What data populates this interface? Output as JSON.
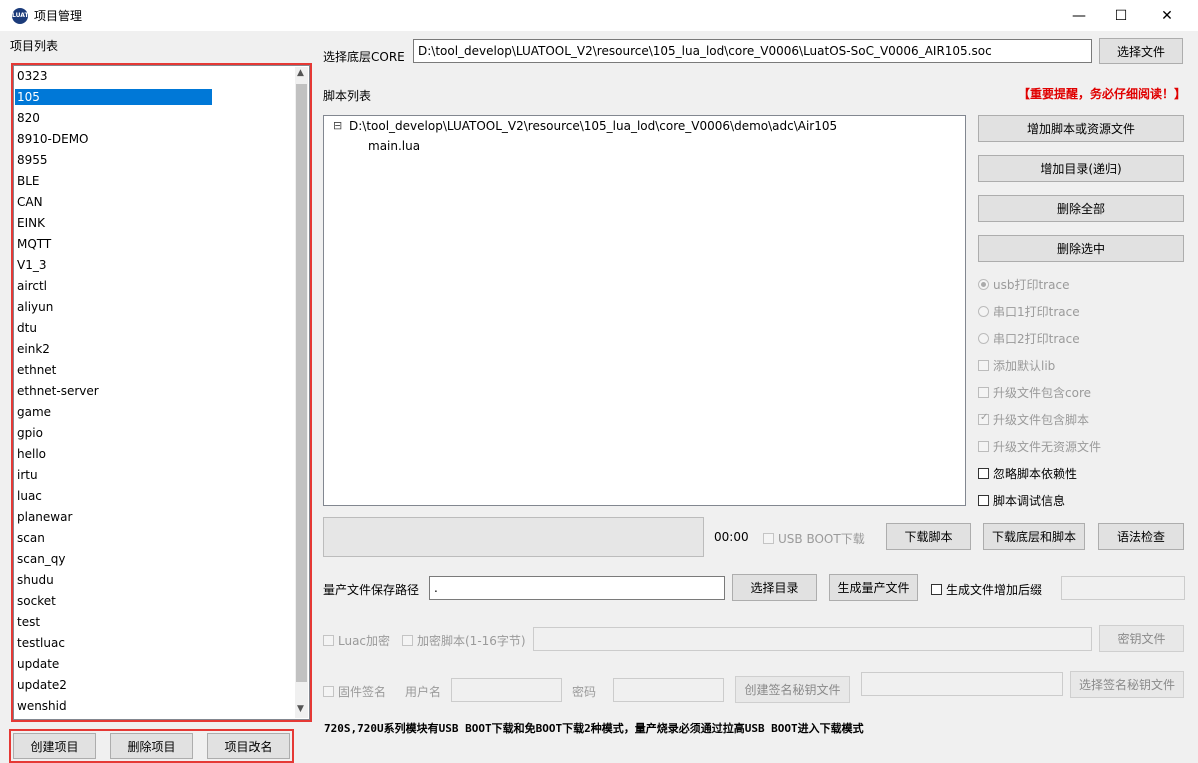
{
  "window": {
    "title": "项目管理",
    "minimize": "—",
    "maximize": "☐",
    "close": "✕"
  },
  "project_list": {
    "label": "项目列表",
    "selected": "105",
    "items": [
      "0323",
      "105",
      "820",
      "8910-DEMO",
      "8955",
      "BLE",
      "CAN",
      "EINK",
      "MQTT",
      "V1_3",
      "airctl",
      "aliyun",
      "dtu",
      "eink2",
      "ethnet",
      "ethnet-server",
      "game",
      "gpio",
      "hello",
      "irtu",
      "luac",
      "planewar",
      "scan",
      "scan_qy",
      "shudu",
      "socket",
      "test",
      "testluac",
      "update",
      "update2",
      "wenshid"
    ],
    "create_button": "创建项目",
    "delete_button": "删除项目",
    "rename_button": "项目改名"
  },
  "core": {
    "label": "选择底层CORE",
    "path": "D:\\tool_develop\\LUATOOL_V2\\resource\\105_lua_lod\\core_V0006\\LuatOS-SoC_V0006_AIR105.soc",
    "select_button": "选择文件"
  },
  "scripts": {
    "label": "脚本列表",
    "warning": "【重要提醒，务必仔细阅读！】",
    "tree_toggle": "⊟",
    "folder": "D:\\tool_develop\\LUATOOL_V2\\resource\\105_lua_lod\\core_V0006\\demo\\adc\\Air105",
    "files": [
      "main.lua"
    ]
  },
  "side_buttons": {
    "add_script": "增加脚本或资源文件",
    "add_dir": "增加目录(递归)",
    "delete_all": "删除全部",
    "delete_selected": "删除选中"
  },
  "options": [
    {
      "label": "usb打印trace",
      "kind": "radio",
      "enabled": false,
      "checked": true
    },
    {
      "label": "串口1打印trace",
      "kind": "radio",
      "enabled": false,
      "checked": false
    },
    {
      "label": "串口2打印trace",
      "kind": "radio",
      "enabled": false,
      "checked": false
    },
    {
      "label": "添加默认lib",
      "kind": "check",
      "enabled": false,
      "checked": false
    },
    {
      "label": "升级文件包含core",
      "kind": "check",
      "enabled": false,
      "checked": false
    },
    {
      "label": "升级文件包含脚本",
      "kind": "check",
      "enabled": false,
      "checked": true
    },
    {
      "label": "升级文件无资源文件",
      "kind": "check",
      "enabled": false,
      "checked": false
    },
    {
      "label": "忽略脚本依赖性",
      "kind": "check",
      "enabled": true,
      "checked": false
    },
    {
      "label": "脚本调试信息",
      "kind": "check",
      "enabled": true,
      "checked": false
    }
  ],
  "download": {
    "timer": "00:00",
    "usb_boot": "USB BOOT下载",
    "download_script": "下载脚本",
    "download_core_script": "下载底层和脚本",
    "syntax_check": "语法检查"
  },
  "mass": {
    "label": "量产文件保存路径",
    "path": ".",
    "select_dir": "选择目录",
    "generate": "生成量产文件",
    "suffix": "生成文件增加后缀"
  },
  "encrypt": {
    "luac": "Luac加密",
    "encrypt_script": "加密脚本(1-16字节)",
    "key_file": "密钥文件"
  },
  "sign": {
    "firmware_sign": "固件签名",
    "username": "用户名",
    "password": "密码",
    "create_key": "创建签名秘钥文件",
    "select_key": "选择签名秘钥文件"
  },
  "notice": "720S,720U系列模块有USB BOOT下载和免BOOT下载2种模式，量产烧录必须通过拉高USB BOOT进入下载模式",
  "colors": {
    "highlight": "#e53935",
    "selection": "#0078d7",
    "warning": "#e00000"
  }
}
